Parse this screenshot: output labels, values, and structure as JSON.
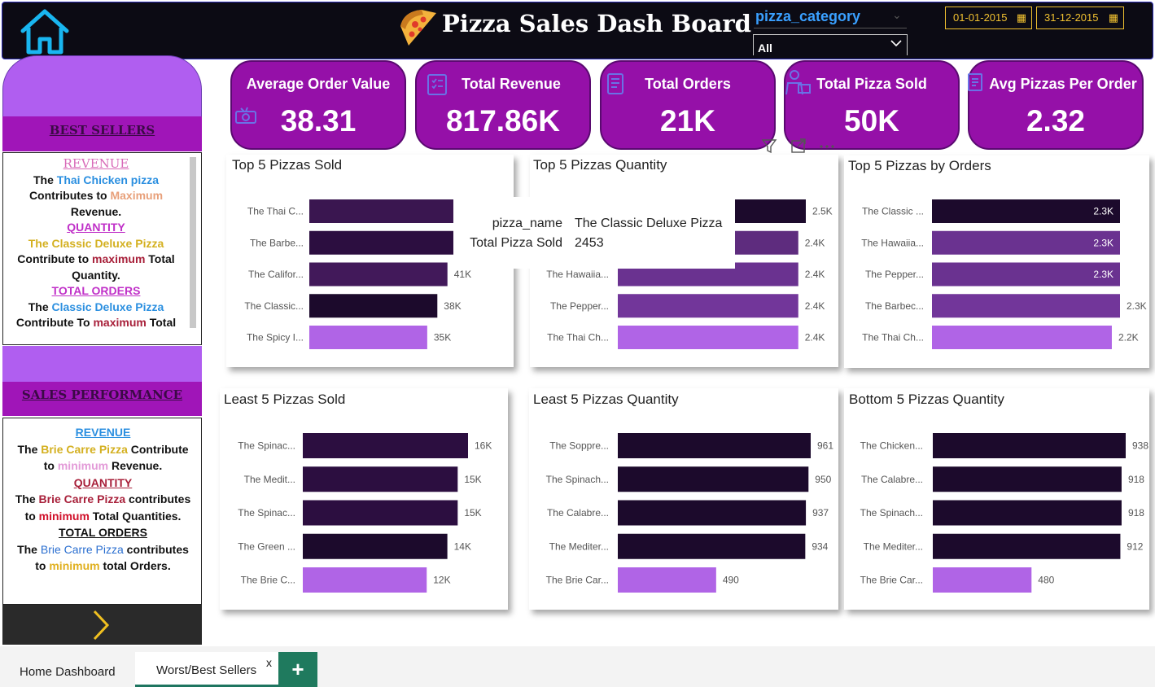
{
  "header": {
    "title": "Pizza Sales Dash Board",
    "slicer_title": "pizza_category",
    "slicer_value": "All",
    "date_start": "01-01-2015",
    "date_end": "31-12-2015",
    "colors": {
      "background": "#0c0b14",
      "date_border": "#f0c030",
      "slicer_title": "#3aa0ff"
    }
  },
  "icons": {
    "home": "home-icon",
    "pizza": "pizza-slice-icon",
    "calendar": "calendar-icon",
    "next": "chevron-right-icon"
  },
  "kpis": [
    {
      "label": "Average Order Value",
      "value": "38.31",
      "icon": "money-icon"
    },
    {
      "label": "Total Revenue",
      "value": "817.86K",
      "icon": "clipboard-list-icon"
    },
    {
      "label": "Total Orders",
      "value": "21K",
      "icon": "order-list-icon"
    },
    {
      "label": "Total Pizza Sold",
      "value": "50K",
      "icon": "delivery-person-icon"
    },
    {
      "label": "Avg Pizzas Per Order",
      "value": "2.32",
      "icon": "receipt-icon"
    }
  ],
  "left_panel": {
    "best_title": "BEST SELLERS",
    "best": {
      "revenue_head": "REVENUE",
      "revenue_l1a": "The ",
      "revenue_l1b": "Thai Chicken pizza",
      "revenue_l2a": "Contributes to ",
      "revenue_l2b": "Maximum",
      "revenue_l3": "Revenue.",
      "quantity_head": "QUANTITY",
      "quantity_l1": "The Classic Deluxe Pizza",
      "quantity_l2a": "Contribute to ",
      "quantity_l2b": "maximum",
      "quantity_l2c": " Total",
      "quantity_l3": "Quantity.",
      "orders_head": "TOTAL ORDERS",
      "orders_l1a": "The ",
      "orders_l1b": "Classic Deluxe Pizza",
      "orders_l2a": "Contribute To ",
      "orders_l2b": "maximum",
      "orders_l2c": " Total"
    },
    "perf_title": "SALES PERFORMANCE",
    "perf": {
      "revenue_head": "REVENUE",
      "revenue_l1a": "The ",
      "revenue_l1b": "Brie Carre Pizza",
      "revenue_l1c": " Contribute",
      "revenue_l2a": "to ",
      "revenue_l2b": "minimum",
      "revenue_l2c": " Revenue.",
      "quantity_head": "QUANTITY",
      "quantity_l1a": "The ",
      "quantity_l1b": "Brie Carre Pizza",
      "quantity_l1c": " contributes",
      "quantity_l2a": "to ",
      "quantity_l2b": "minimum",
      "quantity_l2c": " Total Quantities.",
      "orders_head": "TOTAL ORDERS",
      "orders_l1a": "The ",
      "orders_l1b": "Brie Carre Pizza",
      "orders_l1c": " contributes",
      "orders_l2a": "to ",
      "orders_l2b": "minimum",
      "orders_l2c": " total Orders."
    }
  },
  "tooltip": {
    "label1": "pizza_name",
    "value1": "The Classic Deluxe Pizza",
    "label2": "Total Pizza Sold",
    "value2": "2453"
  },
  "tabs": {
    "home": "Home Dashboard",
    "worst": "Worst/Best Sellers",
    "close": "x",
    "add": "+"
  },
  "chart_data": [
    {
      "type": "bar",
      "orientation": "horizontal",
      "title": "Top 5 Pizzas Sold",
      "categories": [
        "The Thai C...",
        "The Barbe...",
        "The Califor...",
        "The Classic...",
        "The Spicy I..."
      ],
      "values": [
        43,
        43,
        41,
        38,
        35
      ],
      "data_labels": [
        "",
        "",
        "41K",
        "38K",
        "35K"
      ],
      "xlim": [
        0,
        43
      ],
      "colors": [
        "#3a1650",
        "#2c0e40",
        "#42195a",
        "#1c0a2c",
        "#b064e6"
      ]
    },
    {
      "type": "bar",
      "orientation": "horizontal",
      "title": "Top 5 Pizzas Quantity",
      "categories": [
        "",
        "",
        "The Hawaiia...",
        "The Pepper...",
        "The Thai Ch..."
      ],
      "values": [
        2.5,
        2.4,
        2.4,
        2.4,
        2.4
      ],
      "data_labels": [
        "2.5K",
        "2.4K",
        "2.4K",
        "2.4K",
        "2.4K"
      ],
      "xlim": [
        0,
        2.5
      ],
      "colors": [
        "#1c0a2c",
        "#5e2c7e",
        "#6a3290",
        "#72369a",
        "#b064e6"
      ]
    },
    {
      "type": "bar",
      "orientation": "horizontal",
      "title": "Top 5 Pizzas by Orders",
      "categories": [
        "The Classic ...",
        "The Hawaiia...",
        "The Pepper...",
        "The Barbec...",
        "The Thai Ch..."
      ],
      "values": [
        2.3,
        2.3,
        2.3,
        2.3,
        2.2
      ],
      "data_labels": [
        "2.3K",
        "2.3K",
        "2.3K",
        "2.3K",
        "2.2K"
      ],
      "xlim": [
        0,
        2.3
      ],
      "colors": [
        "#1c0a2c",
        "#6a3290",
        "#6a3290",
        "#72369a",
        "#b064e6"
      ]
    },
    {
      "type": "bar",
      "orientation": "horizontal",
      "title": "Least 5 Pizzas Sold",
      "categories": [
        "The Spinac...",
        "The Medit...",
        "The Spinac...",
        "The Green ...",
        "The Brie C..."
      ],
      "values": [
        16,
        15,
        15,
        14,
        12
      ],
      "data_labels": [
        "16K",
        "15K",
        "15K",
        "14K",
        "12K"
      ],
      "xlim": [
        0,
        16
      ],
      "colors": [
        "#2c0e40",
        "#2c0e40",
        "#2c0e40",
        "#1c0a2c",
        "#b064e6"
      ]
    },
    {
      "type": "bar",
      "orientation": "horizontal",
      "title": "Least 5 Pizzas Quantity",
      "categories": [
        "The Soppre...",
        "The Spinach...",
        "The Calabre...",
        "The Mediter...",
        "The Brie Car..."
      ],
      "values": [
        961,
        950,
        937,
        934,
        490
      ],
      "data_labels": [
        "961",
        "950",
        "937",
        "934",
        "490"
      ],
      "xlim": [
        0,
        961
      ],
      "colors": [
        "#1c0a2c",
        "#1c0a2c",
        "#1c0a2c",
        "#1c0a2c",
        "#b064e6"
      ]
    },
    {
      "type": "bar",
      "orientation": "horizontal",
      "title": "Bottom 5 Pizzas Quantity",
      "categories": [
        "The Chicken...",
        "The Calabre...",
        "The Spinach...",
        "The Mediter...",
        "The Brie Car..."
      ],
      "values": [
        938,
        918,
        918,
        912,
        480
      ],
      "data_labels": [
        "938",
        "918",
        "918",
        "912",
        "480"
      ],
      "xlim": [
        0,
        938
      ],
      "colors": [
        "#1c0a2c",
        "#1c0a2c",
        "#1c0a2c",
        "#1c0a2c",
        "#b064e6"
      ]
    }
  ]
}
